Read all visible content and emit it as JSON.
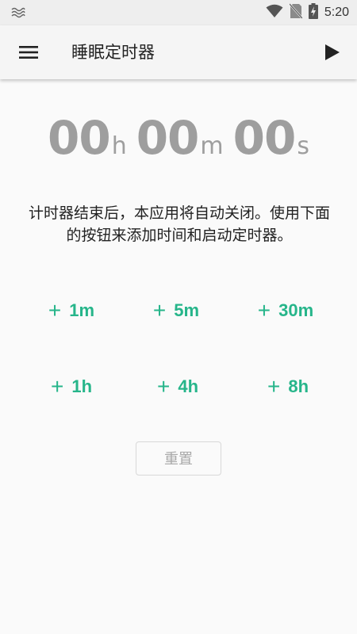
{
  "status_bar": {
    "time": "5:20",
    "icons": [
      "notification-icon",
      "wifi-icon",
      "no-sim-icon",
      "battery-charging-icon"
    ]
  },
  "app_bar": {
    "title": "睡眠定时器",
    "menu_icon": "menu-icon",
    "play_icon": "play-icon"
  },
  "timer": {
    "hours": "00",
    "hours_unit": "h",
    "minutes": "00",
    "minutes_unit": "m",
    "seconds": "00",
    "seconds_unit": "s"
  },
  "description": "计时器结束后，本应用将自动关闭。使用下面的按钮来添加时间和启动定时器。",
  "add_buttons": [
    {
      "plus": "+",
      "label": "1m"
    },
    {
      "plus": "+",
      "label": "5m"
    },
    {
      "plus": "+",
      "label": "30m"
    },
    {
      "plus": "+",
      "label": "1h"
    },
    {
      "plus": "+",
      "label": "4h"
    },
    {
      "plus": "+",
      "label": "8h"
    }
  ],
  "reset_label": "重置",
  "colors": {
    "accent": "#26b58a",
    "timer_text": "#9e9e9e",
    "reset_text": "#a8a8a8"
  }
}
